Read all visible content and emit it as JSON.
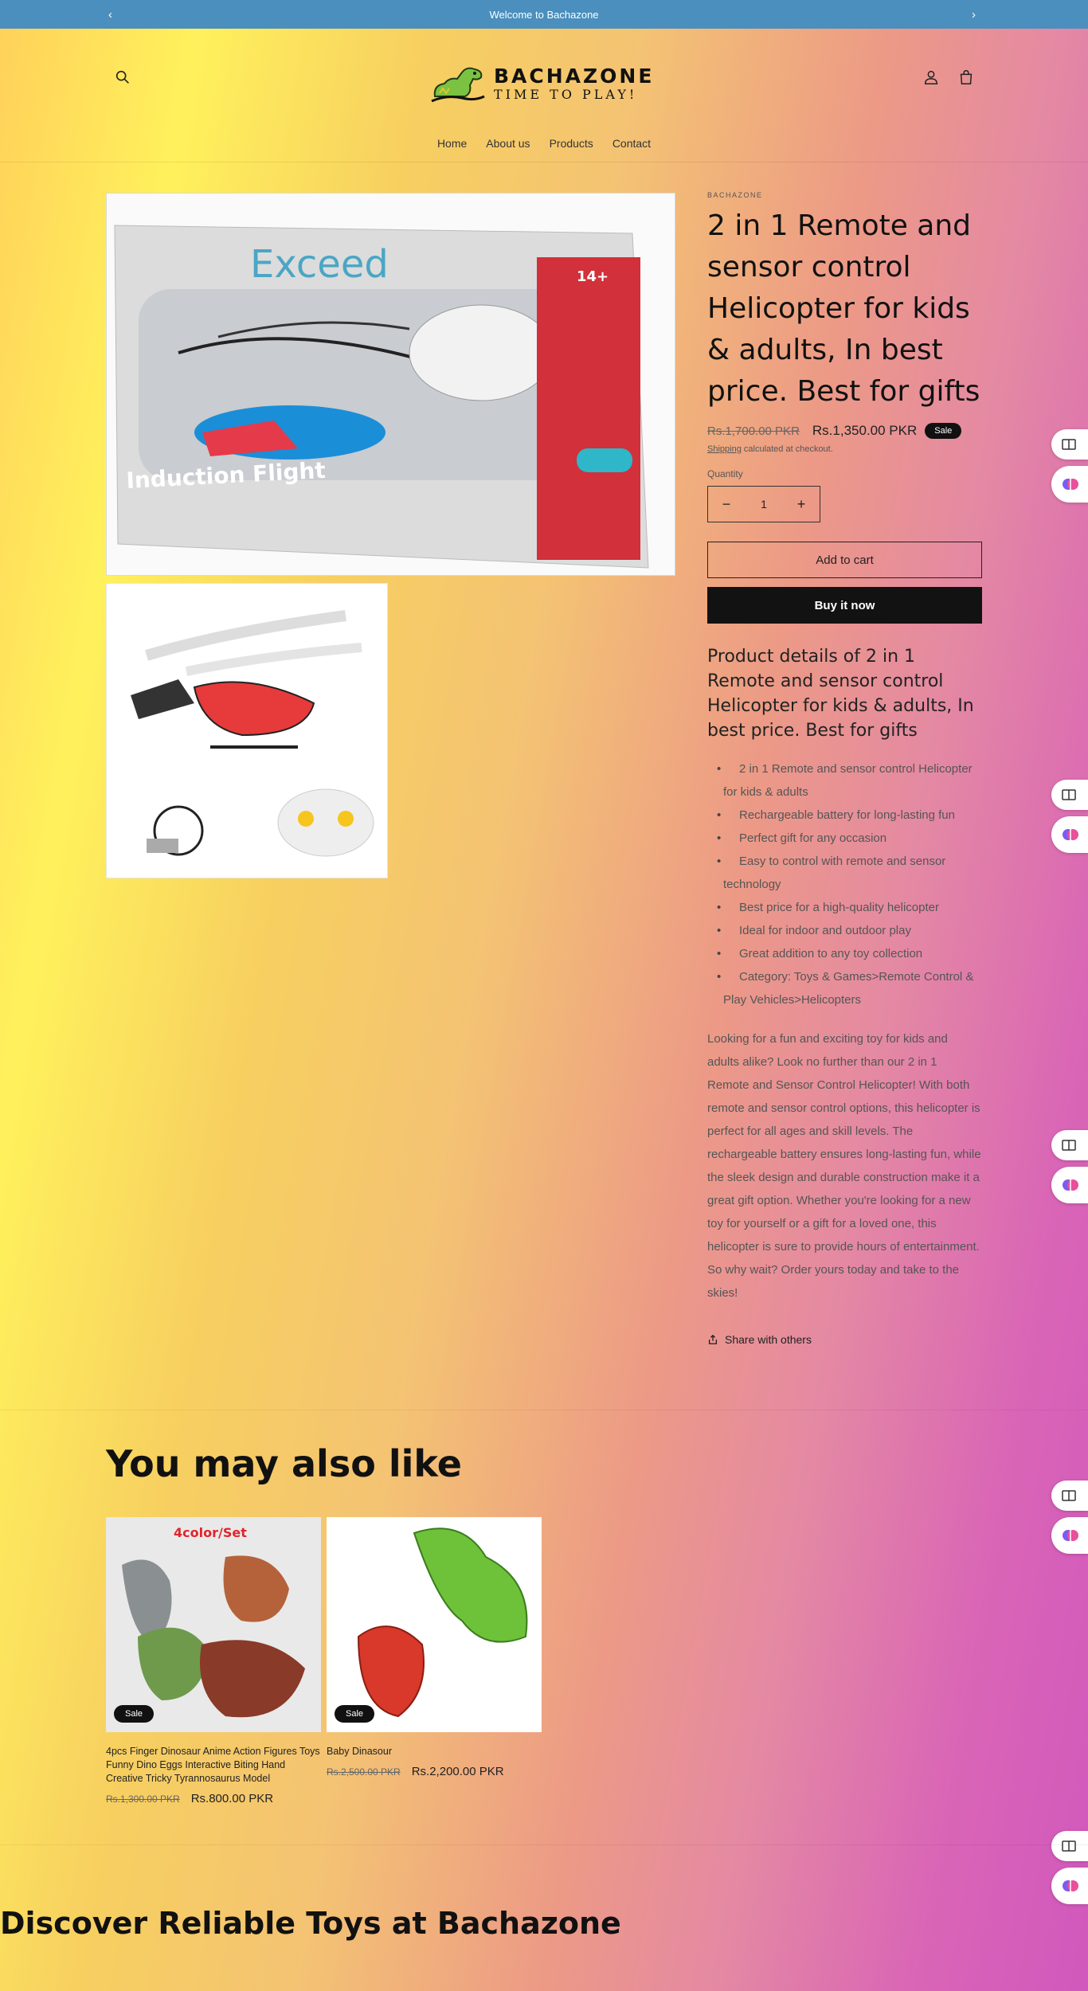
{
  "announcement": {
    "text": "Welcome to Bachazone",
    "prev": "‹",
    "next": "›"
  },
  "header": {
    "brand": "BACHAZONE",
    "tagline": "TIME TO PLAY!",
    "nav": [
      "Home",
      "About us",
      "Products",
      "Contact"
    ]
  },
  "product": {
    "vendor": "BACHAZONE",
    "title": "2 in 1 Remote and sensor control Helicopter for kids & adults, In best price. Best for gifts",
    "price_old": "Rs.1,700.00 PKR",
    "price_new": "Rs.1,350.00 PKR",
    "sale_label": "Sale",
    "shipping_link": "Shipping",
    "shipping_text": " calculated at checkout.",
    "quantity_label": "Quantity",
    "quantity_value": "1",
    "qty_minus": "−",
    "qty_plus": "+",
    "add_to_cart": "Add to cart",
    "buy_now": "Buy it now",
    "details_heading": "Product details of 2 in 1 Remote and sensor control Helicopter for kids & adults, In best price. Best for gifts",
    "bullets": [
      "2 in 1 Remote and sensor control Helicopter for kids & adults",
      "Rechargeable battery for long-lasting fun",
      "Perfect gift for any occasion",
      "Easy to control with remote and sensor technology",
      "Best price for a high-quality helicopter",
      "Ideal for indoor and outdoor play",
      "Great addition to any toy collection",
      "Category: Toys & Games>Remote Control & Play Vehicles>Helicopters"
    ],
    "description": "Looking for a fun and exciting toy for kids and adults alike? Look no further than our 2 in 1 Remote and Sensor Control Helicopter! With both remote and sensor control options, this helicopter is perfect for all ages and skill levels. The rechargeable battery ensures long-lasting fun, while the sleek design and durable construction make it a great gift option. Whether you're looking for a new toy for yourself or a gift for a loved one, this helicopter is sure to provide hours of entertainment. So why wait? Order yours today and take to the skies!",
    "share": "Share with others",
    "image_texts": {
      "box_brand": "Exceed",
      "box_caption": "Induction Flight",
      "age": "14+"
    }
  },
  "related": {
    "heading": "You may also like",
    "items": [
      {
        "name": "4pcs Finger Dinosaur Anime Action Figures Toys Funny Dino Eggs Interactive Biting Hand Creative Tricky Tyrannosaurus Model",
        "price_old": "Rs.1,300.00 PKR",
        "price_new": "Rs.800.00 PKR",
        "badge": "Sale",
        "image_text": "4color/Set"
      },
      {
        "name": "Baby Dinasour",
        "price_old": "Rs.2,500.00 PKR",
        "price_new": "Rs.2,200.00 PKR",
        "badge": "Sale"
      }
    ]
  },
  "discover": {
    "heading": "Discover Reliable Toys at Bachazone"
  },
  "colors": {
    "announcement_bg": "#4a8fbd",
    "button_dark": "#121212",
    "badge": "#111111"
  },
  "icons": [
    "search-icon",
    "account-icon",
    "cart-icon",
    "share-icon",
    "reader-icon",
    "brain-icon"
  ]
}
